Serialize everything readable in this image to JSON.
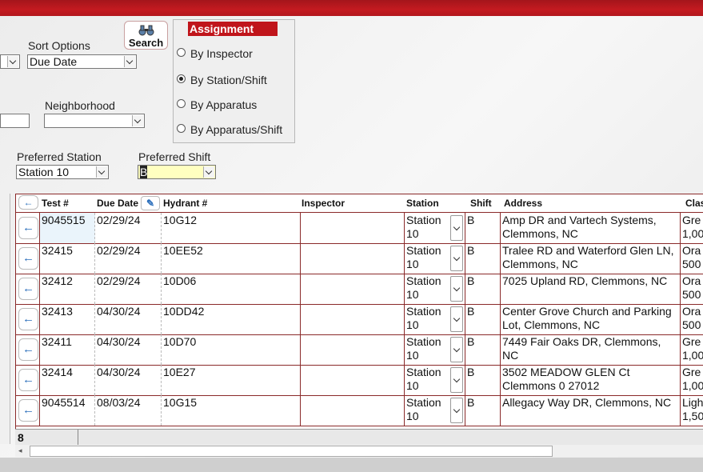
{
  "filters": {
    "sort_label": "Sort Options",
    "sort_value": "Due Date",
    "neighborhood_label": "Neighborhood",
    "neighborhood_value": "",
    "left_input_value": "",
    "preferred_station_label": "Preferred Station",
    "preferred_station_value": "Station 10",
    "preferred_shift_label": "Preferred Shift",
    "preferred_shift_value": "B"
  },
  "search": {
    "label": "Search",
    "icon": "binoculars-icon"
  },
  "assignment": {
    "title": "Assignment",
    "options": [
      {
        "label": "By Inspector",
        "selected": false
      },
      {
        "label": "By Station/Shift",
        "selected": true
      },
      {
        "label": "By Apparatus",
        "selected": false
      },
      {
        "label": "By Apparatus/Shift",
        "selected": false
      }
    ]
  },
  "grid": {
    "headers": {
      "test": "Test #",
      "due": "Due Date",
      "hydrant": "Hydrant #",
      "inspector": "Inspector",
      "station": "Station",
      "shift": "Shift",
      "address": "Address",
      "class": "Clas"
    },
    "rows": [
      {
        "test": "9045515",
        "due": "02/29/24",
        "hydrant": "10G12",
        "inspector": "",
        "station": "Station 10",
        "shift": "B",
        "address": "Amp DR and Vartech Systems, Clemmons, NC",
        "class": "Gre 1,00"
      },
      {
        "test": "32415",
        "due": "02/29/24",
        "hydrant": "10EE52",
        "inspector": "",
        "station": "Station 10",
        "shift": "B",
        "address": "Tralee RD and Waterford Glen LN, Clemmons, NC",
        "class": "Ora 500"
      },
      {
        "test": "32412",
        "due": "02/29/24",
        "hydrant": "10D06",
        "inspector": "",
        "station": "Station 10",
        "shift": "B",
        "address": "7025 Upland RD, Clemmons, NC",
        "class": "Ora 500"
      },
      {
        "test": "32413",
        "due": "04/30/24",
        "hydrant": "10DD42",
        "inspector": "",
        "station": "Station 10",
        "shift": "B",
        "address": "Center Grove Church and Parking Lot, Clemmons, NC",
        "class": "Ora 500"
      },
      {
        "test": "32411",
        "due": "04/30/24",
        "hydrant": "10D70",
        "inspector": "",
        "station": "Station 10",
        "shift": "B",
        "address": "7449 Fair Oaks DR, Clemmons, NC",
        "class": "Gre 1,00"
      },
      {
        "test": "32414",
        "due": "04/30/24",
        "hydrant": "10E27",
        "inspector": "",
        "station": "Station 10",
        "shift": "B",
        "address": " 3502 MEADOW GLEN Ct Clemmons 0 27012",
        "class": "Gre 1,00"
      },
      {
        "test": "9045514",
        "due": "08/03/24",
        "hydrant": "10G15",
        "inspector": "",
        "station": "Station 10",
        "shift": "B",
        "address": "Allegacy Way DR, Clemmons, NC",
        "class": "Ligh 1,50"
      }
    ],
    "record_count": "8"
  },
  "colors": {
    "brand_red": "#c0151b",
    "grid_border": "#8a2a2a",
    "selected_input": "#ffffc0"
  }
}
